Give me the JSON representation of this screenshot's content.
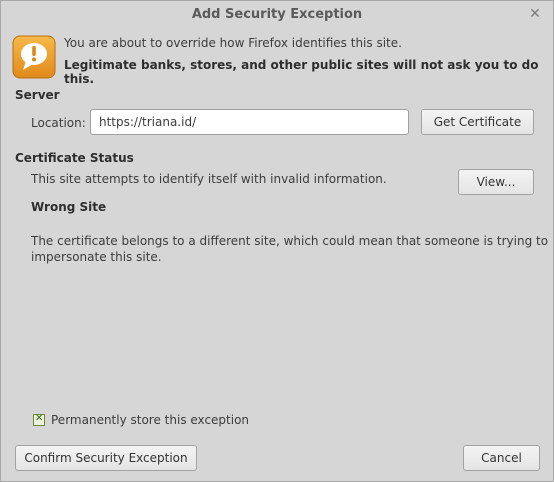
{
  "window": {
    "title": "Add Security Exception",
    "close_glyph": "✕"
  },
  "intro": {
    "line1": "You are about to override how Firefox identifies this site.",
    "line2": "Legitimate banks, stores, and other public sites will not ask you to do this."
  },
  "server": {
    "title": "Server",
    "location_label": "Location:",
    "location_value": "https://triana.id/",
    "get_certificate_label": "Get Certificate"
  },
  "certificate_status": {
    "title": "Certificate Status",
    "summary": "This site attempts to identify itself with invalid information.",
    "view_label": "View...",
    "problem_title": "Wrong Site",
    "problem_line1": "The certificate belongs to a different site, which could mean that someone is trying to",
    "problem_line2": "impersonate this site."
  },
  "permanent": {
    "label": "Permanently store this exception",
    "checked": true
  },
  "actions": {
    "confirm_label": "Confirm Security Exception",
    "cancel_label": "Cancel"
  },
  "colors": {
    "icon_orange": "#f0a030",
    "background": "#d6d6d6"
  },
  "icons": {
    "warning": "warning-speech-bubble-icon"
  }
}
